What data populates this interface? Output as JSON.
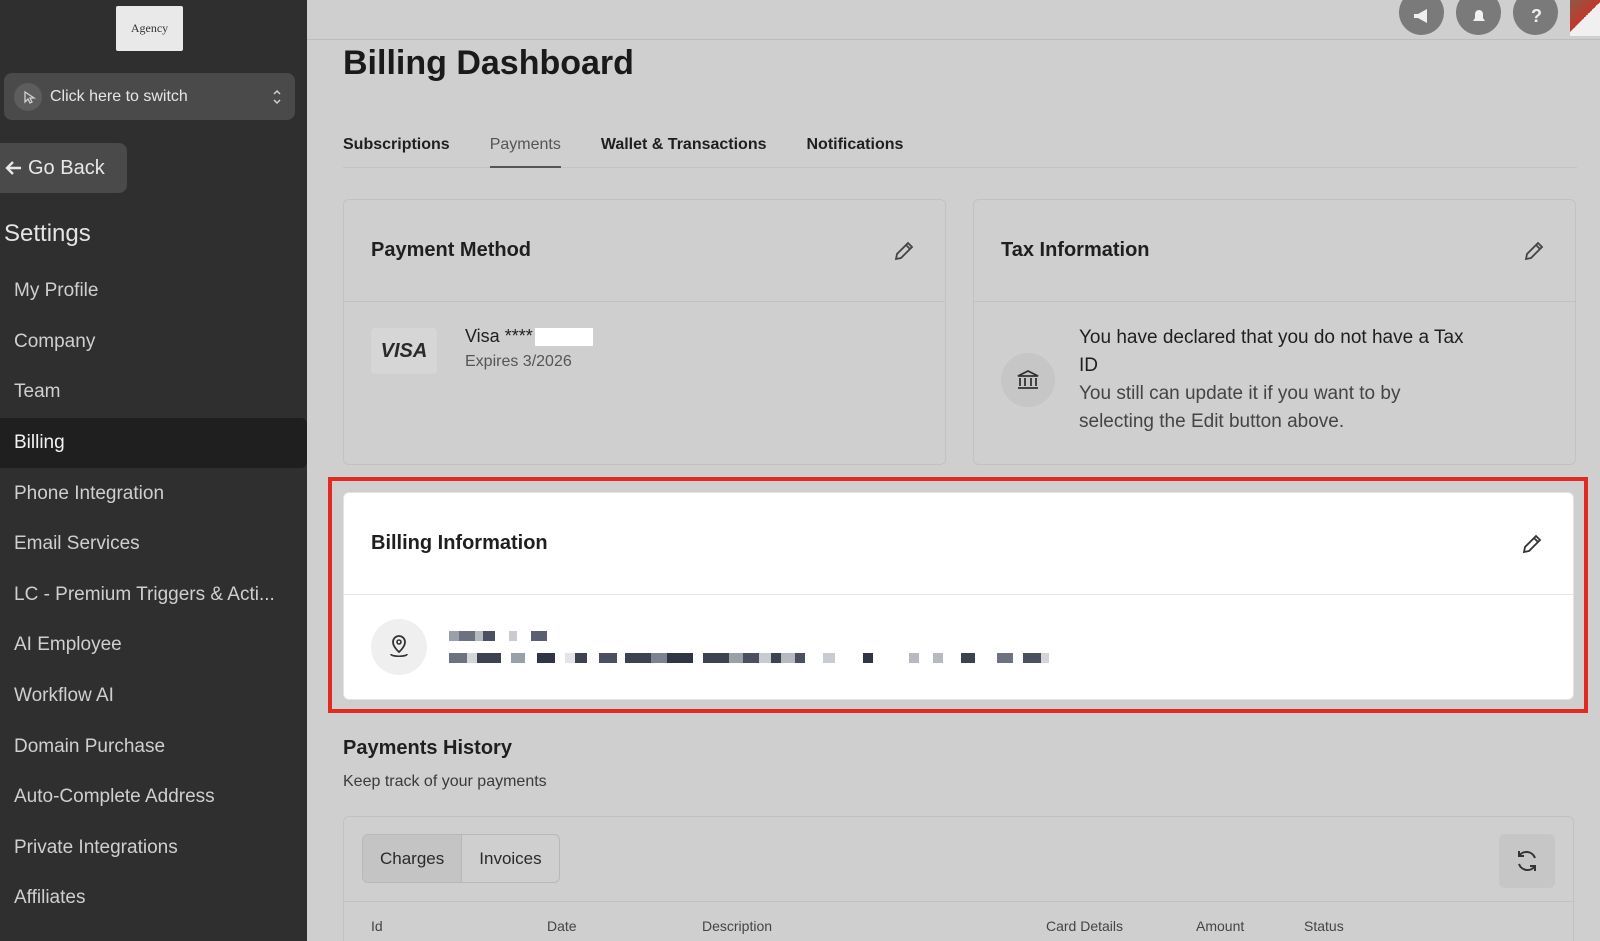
{
  "sidebar": {
    "logo_text": "Agency",
    "switcher_label": "Click here to switch",
    "go_back_label": "Go Back",
    "settings_title": "Settings",
    "items": [
      {
        "label": "My Profile"
      },
      {
        "label": "Company"
      },
      {
        "label": "Team"
      },
      {
        "label": "Billing",
        "active": true
      },
      {
        "label": "Phone Integration"
      },
      {
        "label": "Email Services"
      },
      {
        "label": "LC - Premium Triggers & Acti..."
      },
      {
        "label": "AI Employee"
      },
      {
        "label": "Workflow AI"
      },
      {
        "label": "Domain Purchase"
      },
      {
        "label": "Auto-Complete Address"
      },
      {
        "label": "Private Integrations"
      },
      {
        "label": "Affiliates"
      }
    ]
  },
  "topbar": {
    "icons": [
      "megaphone-icon",
      "bell-icon",
      "help-icon",
      "user-avatar"
    ]
  },
  "main": {
    "page_title": "Billing Dashboard",
    "tabs": [
      {
        "label": "Subscriptions"
      },
      {
        "label": "Payments",
        "active": true
      },
      {
        "label": "Wallet & Transactions"
      },
      {
        "label": "Notifications"
      }
    ],
    "payment_method": {
      "title": "Payment Method",
      "card_brand": "VISA",
      "card_number": "Visa ****",
      "expires": "Expires 3/2026"
    },
    "tax_information": {
      "title": "Tax Information",
      "line1": "You have declared that you do not have a Tax ID",
      "line2": "You still can update it if you want to by selecting the Edit button above."
    },
    "billing_information": {
      "title": "Billing Information",
      "highlight_color": "#e02a22"
    },
    "payments_history": {
      "title": "Payments History",
      "subtitle": "Keep track of your payments",
      "segments": [
        {
          "label": "Charges",
          "active": true
        },
        {
          "label": "Invoices"
        }
      ],
      "columns": [
        "Id",
        "Date",
        "Description",
        "Card Details",
        "Amount",
        "Status"
      ]
    }
  }
}
